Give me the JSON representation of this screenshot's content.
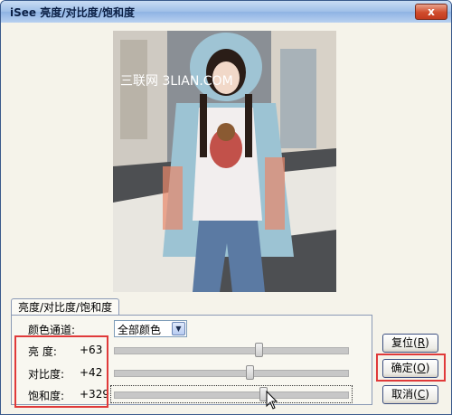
{
  "window": {
    "title": "iSee 亮度/对比度/饱和度",
    "close_glyph": "x"
  },
  "photo": {
    "watermark": "三联网 3LIAN.COM"
  },
  "tab": {
    "label": "亮度/对比度/饱和度"
  },
  "channel": {
    "label": "颜色通道:",
    "selected": "全部颜色"
  },
  "sliders": [
    {
      "label": "亮  度:",
      "value_text": "+63",
      "value": 63,
      "fraction": 0.62
    },
    {
      "label": "对比度:",
      "value_text": "+42",
      "value": 42,
      "fraction": 0.58
    },
    {
      "label": "饱和度:",
      "value_text": "+329",
      "value": 329,
      "fraction": 0.64
    }
  ],
  "buttons": {
    "reset": "复位",
    "reset_key": "R",
    "ok": "确定",
    "ok_key": "O",
    "cancel": "取消",
    "cancel_key": "C"
  },
  "colors": {
    "highlight_box": "#e03a3a",
    "titlebar": "#9fbfe8"
  }
}
